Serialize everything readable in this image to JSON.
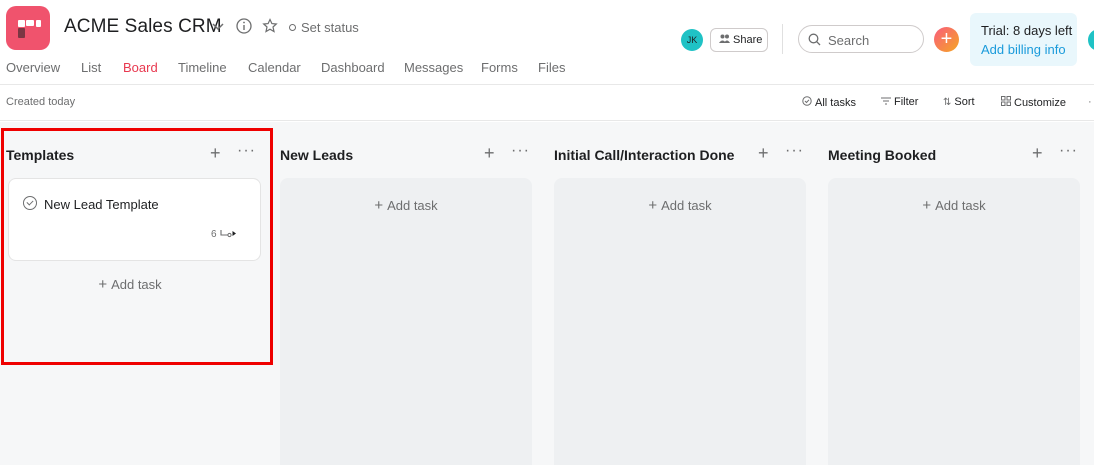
{
  "header": {
    "project_title": "ACME Sales CRM",
    "set_status": "Set status",
    "avatar_initials": "JK",
    "share_label": "Share",
    "search_placeholder": "Search",
    "trial_text": "Trial: 8 days left",
    "billing_link": "Add billing info",
    "accent_color": "#e8384f",
    "icons": [
      "project-icon",
      "chevron-down-icon",
      "info-icon",
      "star-icon",
      "status-dot-icon",
      "people-icon",
      "search-icon",
      "plus-icon"
    ]
  },
  "tabs": [
    {
      "label": "Overview"
    },
    {
      "label": "List"
    },
    {
      "label": "Board",
      "active": true
    },
    {
      "label": "Timeline"
    },
    {
      "label": "Calendar"
    },
    {
      "label": "Dashboard"
    },
    {
      "label": "Messages"
    },
    {
      "label": "Forms"
    },
    {
      "label": "Files"
    }
  ],
  "toolbar": {
    "created": "Created today",
    "all_tasks": "All tasks",
    "filter": "Filter",
    "sort": "Sort",
    "customize": "Customize"
  },
  "columns": [
    {
      "title": "Templates",
      "tasks": [
        {
          "name": "New Lead Template",
          "subtask_count": "6"
        }
      ],
      "add_task": "Add task"
    },
    {
      "title": "New Leads",
      "tasks": [],
      "add_task": "Add task"
    },
    {
      "title": "Initial Call/Interaction Done",
      "tasks": [],
      "add_task": "Add task"
    },
    {
      "title": "Meeting Booked",
      "tasks": [],
      "add_task": "Add task"
    }
  ]
}
